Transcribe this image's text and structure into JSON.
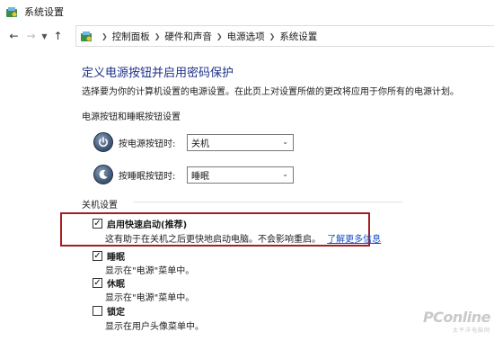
{
  "window": {
    "title": "系统设置"
  },
  "nav": {
    "back_icon": "arrow-left",
    "forward_icon": "arrow-right",
    "recent_icon": "chevron-down",
    "up_icon": "arrow-up"
  },
  "breadcrumb": {
    "items": [
      "控制面板",
      "硬件和声音",
      "电源选项",
      "系统设置"
    ]
  },
  "page": {
    "title": "定义电源按钮并启用密码保护",
    "description": "选择要为你的计算机设置的电源设置。在此页上对设置所做的更改将应用于你所有的电源计划。"
  },
  "power_buttons": {
    "section_title": "电源按钮和睡眠按钮设置",
    "power_button": {
      "label": "按电源按钮时:",
      "value": "关机"
    },
    "sleep_button": {
      "label": "按睡眠按钮时:",
      "value": "睡眠"
    }
  },
  "shutdown": {
    "section_title": "关机设置",
    "options": [
      {
        "label": "启用快速启动(推荐)",
        "checked": true,
        "description": "这有助于在关机之后更快地启动电脑。不会影响重启。",
        "link": "了解更多信息"
      },
      {
        "label": "睡眠",
        "checked": true,
        "description": "显示在\"电源\"菜单中。"
      },
      {
        "label": "休眠",
        "checked": true,
        "description": "显示在\"电源\"菜单中。"
      },
      {
        "label": "锁定",
        "checked": false,
        "description": "显示在用户头像菜单中。"
      }
    ]
  },
  "watermark": {
    "logo": "PConline",
    "sub": "太平洋电脑网"
  },
  "colors": {
    "title_blue": "#1e3287",
    "highlight_red": "#a51e22",
    "link_blue": "#1a4fc4"
  }
}
